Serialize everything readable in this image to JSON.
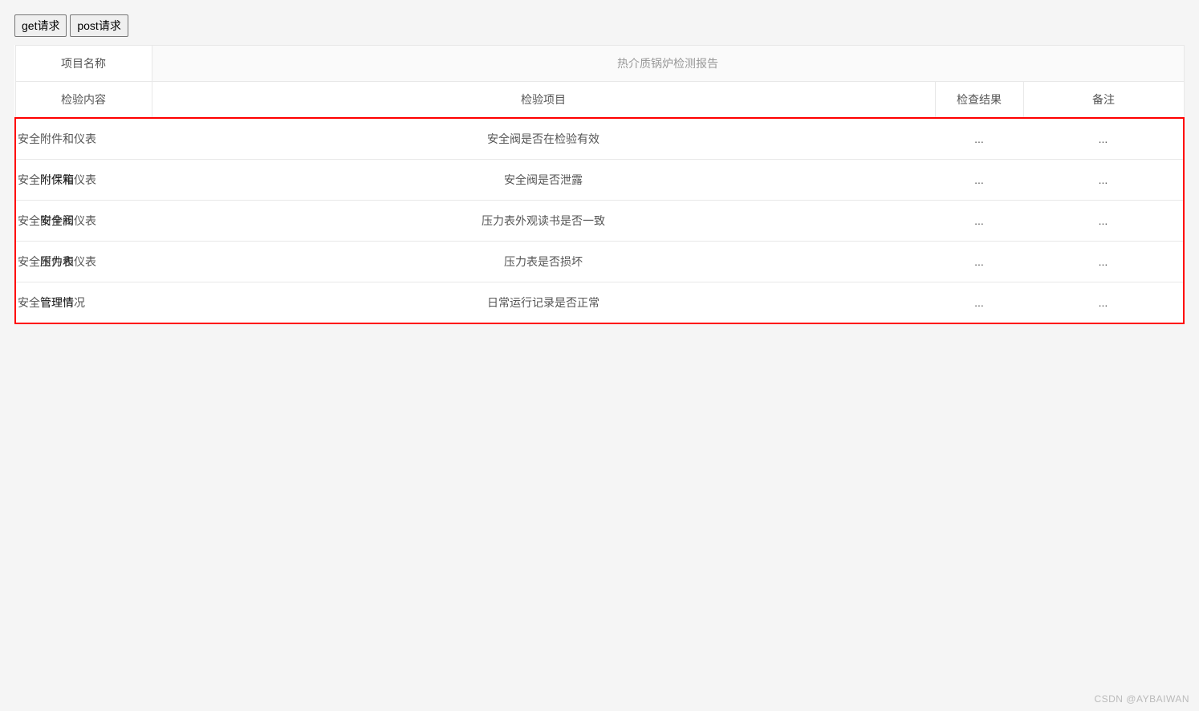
{
  "buttons": {
    "get": "get请求",
    "post": "post请求"
  },
  "header": {
    "project_name_label": "项目名称",
    "project_value": "热介质锅炉检测报告"
  },
  "columns": {
    "content": "检验内容",
    "item": "检验项目",
    "result": "检查结果",
    "note": "备注"
  },
  "rows": [
    {
      "content_base": "安全附件和仪表",
      "content_overlay": "",
      "item": "安全阀是否在检验有效",
      "result": "...",
      "note": "..."
    },
    {
      "content_base": "安全附件和仪表",
      "content_overlay": "附保箱",
      "item": "安全阀是否泄露",
      "result": "...",
      "note": "..."
    },
    {
      "content_base": "安全附件和仪表",
      "content_overlay": "安全阀",
      "item": "压力表外观读书是否一致",
      "result": "...",
      "note": "..."
    },
    {
      "content_base": "安全附件和仪表",
      "content_overlay": "压力表",
      "item": "压力表是否损坏",
      "result": "...",
      "note": "..."
    },
    {
      "content_base": "安全管理情况",
      "content_overlay": "管理情",
      "item": "日常运行记录是否正常",
      "result": "...",
      "note": "..."
    }
  ],
  "watermark": "CSDN @AYBAIWAN"
}
